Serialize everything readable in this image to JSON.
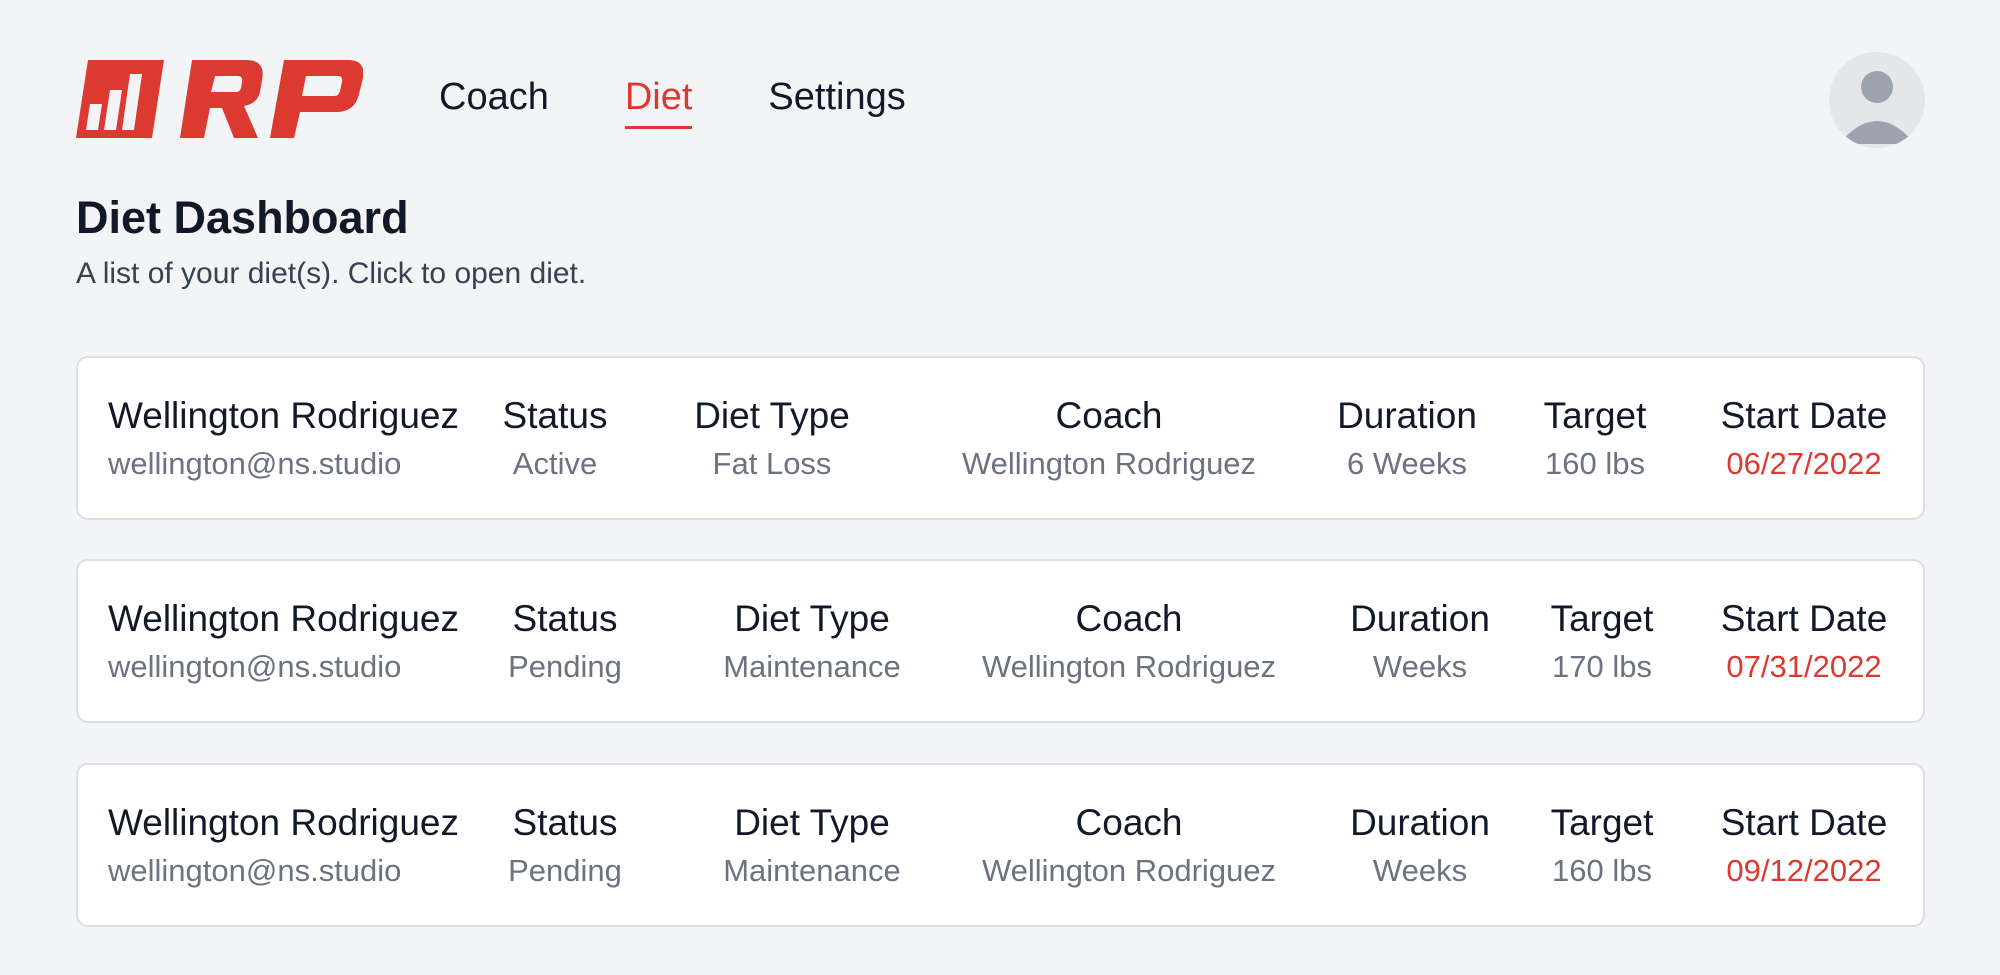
{
  "nav": {
    "items": [
      {
        "label": "Coach",
        "active": false
      },
      {
        "label": "Diet",
        "active": true
      },
      {
        "label": "Settings",
        "active": false
      }
    ]
  },
  "page": {
    "title": "Diet Dashboard",
    "subtitle": "A list of your diet(s). Click to open diet."
  },
  "colors": {
    "accent": "#dc3a30",
    "background": "#f3f4f6",
    "card": "#ffffff",
    "muted_text": "#6b7280"
  },
  "labels": {
    "status": "Status",
    "diet_type": "Diet Type",
    "coach": "Coach",
    "duration": "Duration",
    "target": "Target",
    "start_date": "Start Date"
  },
  "diets": [
    {
      "name": "Wellington Rodriguez",
      "email": "wellington@ns.studio",
      "status": "Active",
      "diet_type": "Fat Loss",
      "coach": "Wellington Rodriguez",
      "duration": "6 Weeks",
      "target": "160 lbs",
      "start_date": "06/27/2022"
    },
    {
      "name": "Wellington Rodriguez",
      "email": "wellington@ns.studio",
      "status": "Pending",
      "diet_type": "Maintenance",
      "coach": "Wellington Rodriguez",
      "duration": "Weeks",
      "target": "170 lbs",
      "start_date": "07/31/2022"
    },
    {
      "name": "Wellington Rodriguez",
      "email": "wellington@ns.studio",
      "status": "Pending",
      "diet_type": "Maintenance",
      "coach": "Wellington Rodriguez",
      "duration": "Weeks",
      "target": "160 lbs",
      "start_date": "09/12/2022"
    }
  ]
}
